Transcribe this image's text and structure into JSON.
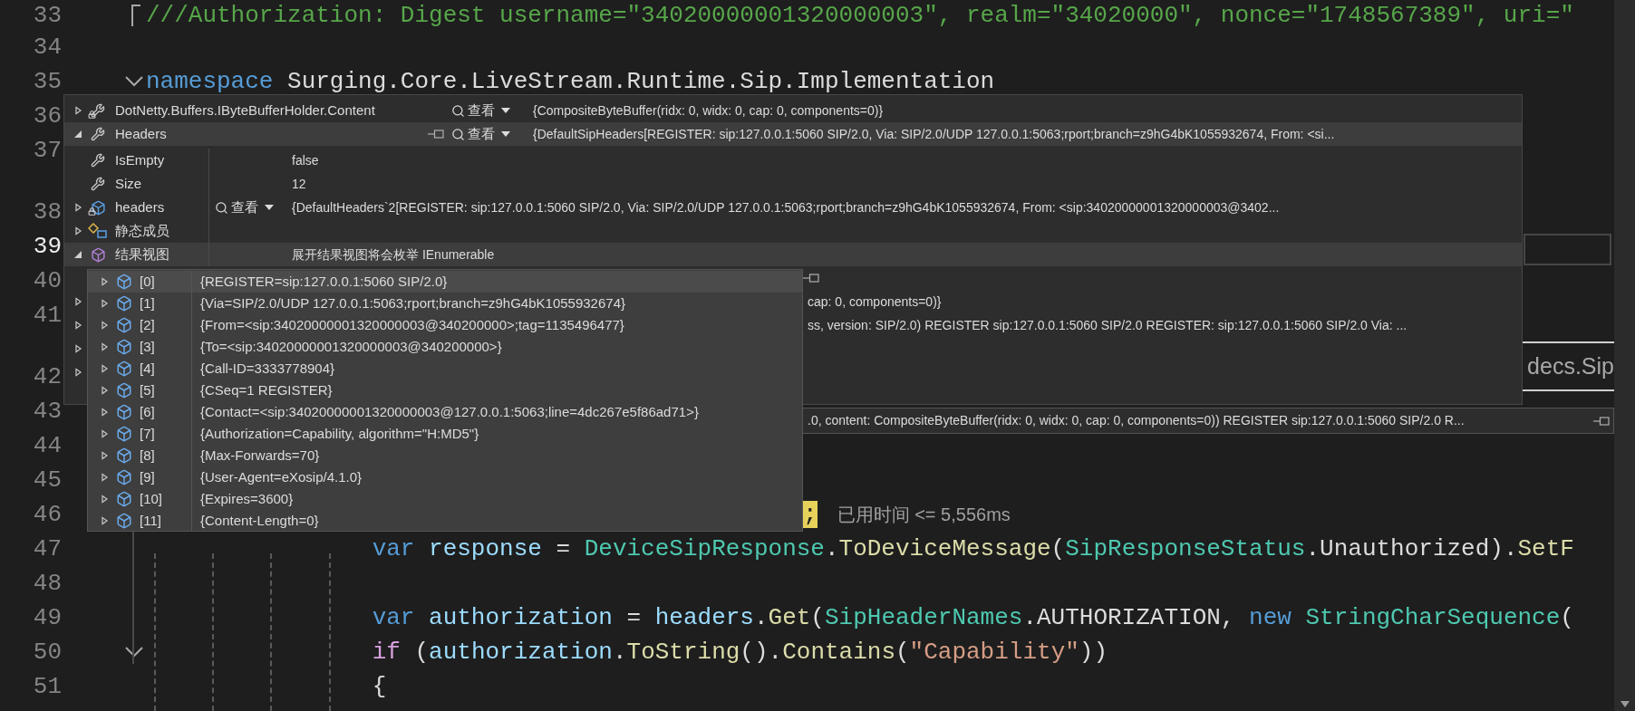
{
  "editor": {
    "lines": [
      {
        "kind": "code",
        "number": "33",
        "current": false,
        "fold": {
          "kind": "bracket"
        },
        "tokens": [
          {
            "text": "///Authorization: Digest username=\"34020000001320000003\", realm=\"34020000\", nonce=\"1748567389\", uri=\"",
            "kind": "comment"
          }
        ]
      },
      {
        "kind": "code",
        "number": "34",
        "current": false
      },
      {
        "kind": "code",
        "number": "35",
        "current": false,
        "fold": {
          "kind": "chevron"
        },
        "tokens": [
          {
            "text": "namespace ",
            "kind": "keyword"
          },
          {
            "text": "Surging.Core.LiveStream.Runtime.Sip.Implementation",
            "kind": "plain"
          }
        ]
      },
      {
        "kind": "code",
        "number": "36",
        "current": false
      },
      {
        "kind": "code",
        "number": "37",
        "current": false
      },
      {
        "kind": "lens"
      },
      {
        "kind": "code",
        "number": "38",
        "current": false
      },
      {
        "kind": "code",
        "number": "39",
        "current": true
      },
      {
        "kind": "code",
        "number": "40",
        "current": false
      },
      {
        "kind": "code",
        "number": "41",
        "current": false
      },
      {
        "kind": "lens"
      },
      {
        "kind": "code",
        "number": "42",
        "current": false
      },
      {
        "kind": "code",
        "number": "43",
        "current": false
      },
      {
        "kind": "code",
        "number": "44",
        "current": false
      },
      {
        "kind": "code",
        "number": "45",
        "current": false
      },
      {
        "kind": "tail",
        "number": "46",
        "current": false,
        "tokens": [
          {
            "text": ";",
            "kind": "highlight"
          }
        ],
        "tip": "已用时间 <= 5,556ms"
      },
      {
        "kind": "code",
        "number": "47",
        "current": false,
        "tokens": [
          {
            "text": "                var ",
            "kind": "keyword"
          },
          {
            "text": "response",
            "kind": "local"
          },
          {
            "text": " = ",
            "kind": "plain"
          },
          {
            "text": "DeviceSipResponse",
            "kind": "type"
          },
          {
            "text": ".",
            "kind": "plain"
          },
          {
            "text": "ToDeviceMessage",
            "kind": "method"
          },
          {
            "text": "(",
            "kind": "plain"
          },
          {
            "text": "SipResponseStatus",
            "kind": "type"
          },
          {
            "text": ".Unauthorized).",
            "kind": "plain"
          },
          {
            "text": "SetF",
            "kind": "method"
          }
        ]
      },
      {
        "kind": "code",
        "number": "48",
        "current": false
      },
      {
        "kind": "code",
        "number": "49",
        "current": false,
        "tokens": [
          {
            "text": "                var ",
            "kind": "keyword"
          },
          {
            "text": "authorization",
            "kind": "local"
          },
          {
            "text": " = ",
            "kind": "plain"
          },
          {
            "text": "headers",
            "kind": "local"
          },
          {
            "text": ".",
            "kind": "plain"
          },
          {
            "text": "Get",
            "kind": "method"
          },
          {
            "text": "(",
            "kind": "plain"
          },
          {
            "text": "SipHeaderNames",
            "kind": "type"
          },
          {
            "text": ".AUTHORIZATION, ",
            "kind": "plain"
          },
          {
            "text": "new ",
            "kind": "keyword"
          },
          {
            "text": "StringCharSequence",
            "kind": "type"
          },
          {
            "text": "(",
            "kind": "plain"
          }
        ]
      },
      {
        "kind": "code",
        "number": "50",
        "current": false,
        "fold": {
          "kind": "chevron"
        },
        "tokens": [
          {
            "text": "                if",
            "kind": "control"
          },
          {
            "text": " (",
            "kind": "plain"
          },
          {
            "text": "authorization",
            "kind": "local"
          },
          {
            "text": ".",
            "kind": "plain"
          },
          {
            "text": "ToString",
            "kind": "method"
          },
          {
            "text": "().",
            "kind": "plain"
          },
          {
            "text": "Contains",
            "kind": "method"
          },
          {
            "text": "(",
            "kind": "plain"
          },
          {
            "text": "\"Capability\"",
            "kind": "string"
          },
          {
            "text": "))",
            "kind": "plain"
          }
        ]
      },
      {
        "kind": "code",
        "number": "51",
        "current": false,
        "tokens": [
          {
            "text": "                {",
            "kind": "plain"
          }
        ]
      }
    ]
  },
  "editor_fragment": "decs.Sip",
  "datatip": {
    "rows": [
      {
        "kind": "property-locked",
        "name": "DotNetty.Buffers.IByteBufferHolder.Content",
        "expanded": false,
        "selected": false,
        "pinned": false,
        "view_label": "查看",
        "value": "{CompositeByteBuffer(ridx: 0, widx: 0, cap: 0, components=0)}"
      },
      {
        "kind": "property",
        "name": "Headers",
        "expanded": true,
        "selected": true,
        "pinned": true,
        "view_label": "查看",
        "value": "{DefaultSipHeaders[REGISTER: sip:127.0.0.1:5060 SIP/2.0, Via: SIP/2.0/UDP 127.0.0.1:5063;rport;branch=z9hG4bK1055932674, From: <si...",
        "children": [
          {
            "kind": "property",
            "name": "IsEmpty",
            "selected": false,
            "pinned": false,
            "value": "false"
          },
          {
            "kind": "property",
            "name": "Size",
            "selected": false,
            "pinned": false,
            "value": "12"
          },
          {
            "kind": "field-locked",
            "name": "headers",
            "expanded": false,
            "selected": false,
            "pinned": false,
            "view_label": "查看",
            "value": "{DefaultHeaders`2[REGISTER: sip:127.0.0.1:5060 SIP/2.0, Via: SIP/2.0/UDP 127.0.0.1:5063;rport;branch=z9hG4bK1055932674, From: <sip:34020000001320000003@3402..."
          },
          {
            "kind": "static",
            "name": "静态成员",
            "expanded": false,
            "selected": false,
            "pinned": false
          },
          {
            "kind": "results",
            "name": "结果视图",
            "expanded": true,
            "selected": true,
            "pinned": false,
            "value": "展开结果视图将会枚举 IEnumerable",
            "children": [
              {
                "kind": "item",
                "name": "[0]",
                "expanded": false,
                "selected": true,
                "value": "{REGISTER=sip:127.0.0.1:5060 SIP/2.0}"
              },
              {
                "kind": "item",
                "name": "[1]",
                "expanded": false,
                "selected": false,
                "value": "{Via=SIP/2.0/UDP 127.0.0.1:5063;rport;branch=z9hG4bK1055932674}"
              },
              {
                "kind": "item",
                "name": "[2]",
                "expanded": false,
                "selected": false,
                "value": "{From=<sip:34020000001320000003@340200000>;tag=1135496477}"
              },
              {
                "kind": "item",
                "name": "[3]",
                "expanded": false,
                "selected": false,
                "value": "{To=<sip:34020000001320000003@340200000>}"
              },
              {
                "kind": "item",
                "name": "[4]",
                "expanded": false,
                "selected": false,
                "value": "{Call-ID=3333778904}"
              },
              {
                "kind": "item",
                "name": "[5]",
                "expanded": false,
                "selected": false,
                "value": "{CSeq=1 REGISTER}"
              },
              {
                "kind": "item",
                "name": "[6]",
                "expanded": false,
                "selected": false,
                "value": "{Contact=<sip:34020000001320000003@127.0.0.1:5063;line=4dc267e5f86ad71>}"
              },
              {
                "kind": "item",
                "name": "[7]",
                "expanded": false,
                "selected": false,
                "value": "{Authorization=Capability, algorithm=\"H:MD5\"}"
              },
              {
                "kind": "item",
                "name": "[8]",
                "expanded": false,
                "selected": false,
                "value": "{Max-Forwards=70}"
              },
              {
                "kind": "item",
                "name": "[9]",
                "expanded": false,
                "selected": false,
                "value": "{User-Agent=eXosip/4.1.0}"
              },
              {
                "kind": "item",
                "name": "[10]",
                "expanded": false,
                "selected": false,
                "value": "{Expires=3600}"
              },
              {
                "kind": "item",
                "name": "[11]",
                "expanded": false,
                "selected": false,
                "value": "{Content-Length=0}"
              }
            ]
          }
        ]
      }
    ],
    "covered_rows": [
      {
        "pinned": true
      },
      {
        "expanded": false,
        "pinned": false,
        "value": "cap: 0, components=0)}"
      },
      {
        "expanded": false,
        "pinned": false,
        "value": "ss, version: SIP/2.0) REGISTER sip:127.0.0.1:5060 SIP/2.0 REGISTER: sip:127.0.0.1:5060 SIP/2.0 Via: ..."
      },
      {
        "expanded": false,
        "pinned": false
      },
      {
        "expanded": false,
        "pinned": false
      }
    ]
  },
  "datatip_bar": {
    "value": ".0, content: CompositeByteBuffer(ridx: 0, widx: 0, cap: 0, components=0)) REGISTER sip:127.0.0.1:5060 SIP/2.0 R...",
    "pinned": true
  }
}
